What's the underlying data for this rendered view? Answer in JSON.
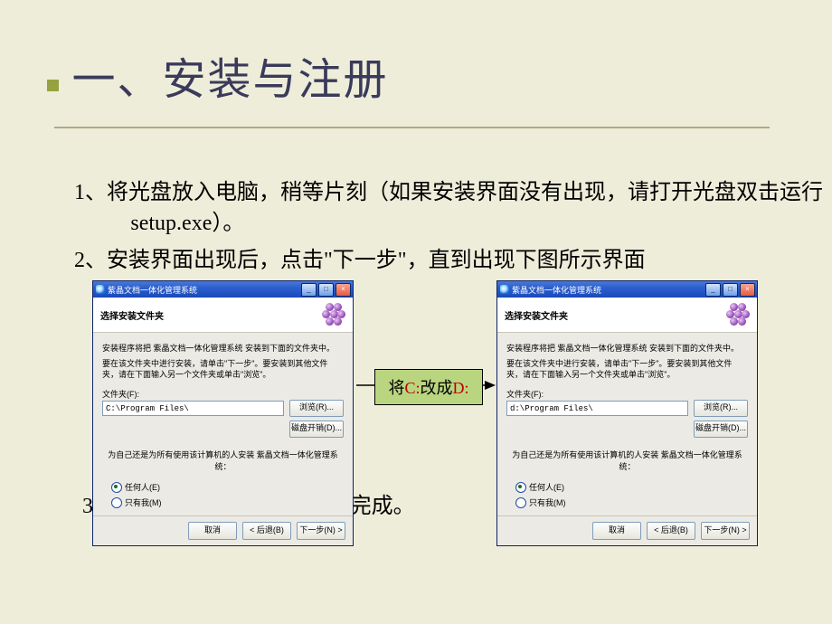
{
  "slide": {
    "title": "一、安装与注册",
    "paragraphs": {
      "p1": "1、将光盘放入电脑，稍等片刻（如果安装界面没有出现，请打开光盘双击运行setup.exe）。",
      "p2": "2、安装界面出现后，点击\"下一步\"，直到出现下图所示界面",
      "p3": "3、点击\"下一步\"，直到安装完成。"
    }
  },
  "callout": {
    "prefix": "将",
    "from": "C:",
    "mid": "改成",
    "to": "D:"
  },
  "installer": {
    "title": "紫晶文档一体化管理系统",
    "header_title": "选择安装文件夹",
    "line1": "安装程序将把 紫晶文档一体化管理系统 安装到下面的文件夹中。",
    "line2": "要在该文件夹中进行安装，请单击\"下一步\"。要安装到其他文件夹，请在下面输入另一个文件夹或单击\"浏览\"。",
    "folder_label": "文件夹(F):",
    "path_a": "C:\\Program Files\\",
    "path_b": "d:\\Program Files\\",
    "browse": "浏览(R)...",
    "disk_cost": "磁盘开销(D)...",
    "note": "为自己还是为所有使用该计算机的人安装 紫晶文档一体化管理系统：",
    "radio_all": "任何人(E)",
    "radio_me": "只有我(M)",
    "cancel": "取消",
    "back": "< 后退(B)",
    "next": "下一步(N) >"
  },
  "win_controls": {
    "min": "_",
    "max": "□",
    "close": "×"
  }
}
